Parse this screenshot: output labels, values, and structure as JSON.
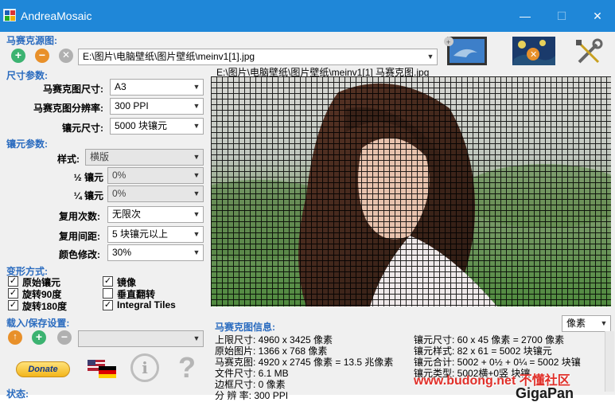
{
  "window": {
    "title": "AndreaMosaic",
    "minimize": "—",
    "maximize": "☐",
    "close": "✕"
  },
  "source": {
    "section_title": "马赛克源图:",
    "path": "E:\\图片\\电脑壁纸\\图片壁纸\\meinv1[1].jpg",
    "preview_caption": "E:\\图片\\电脑壁纸\\图片壁纸\\meinv1[1] 马赛克图.jpg"
  },
  "size_params": {
    "section_title": "尺寸参数:",
    "mosaic_size_label": "马赛克图尺寸:",
    "mosaic_size_value": "A3",
    "resolution_label": "马赛克图分辨率:",
    "resolution_value": "300 PPI",
    "tile_size_label": "镶元尺寸:",
    "tile_size_value": "5000 块镶元"
  },
  "tile_params": {
    "section_title": "镶元参数:",
    "style_label": "样式:",
    "style_value": "横版",
    "half_label": "½ 镶元",
    "half_value": "0%",
    "quarter_label": "¼ 镶元",
    "quarter_value": "0%",
    "reuse_count_label": "复用次数:",
    "reuse_count_value": "无限次",
    "reuse_distance_label": "复用间距:",
    "reuse_distance_value": "5 块镶元以上",
    "color_label": "颜色修改:",
    "color_value": "30%"
  },
  "transform": {
    "section_title": "变形方式:",
    "options": [
      {
        "label": "原始镶元",
        "checked": "✓"
      },
      {
        "label": "镜像",
        "checked": "✓"
      },
      {
        "label": "旋转90度",
        "checked": "✓"
      },
      {
        "label": "垂直翻转",
        "checked": ""
      },
      {
        "label": "旋转180度",
        "checked": "✓"
      },
      {
        "label": "Integral Tiles",
        "checked": "✓"
      }
    ]
  },
  "load_save": {
    "section_title": "载入/保存设置:"
  },
  "status": {
    "label": "状态:"
  },
  "bottom": {
    "donate": "Donate",
    "info_symbol": "i",
    "help_symbol": "?"
  },
  "info_panel": {
    "title": "马赛克图信息:",
    "unit": "像素",
    "left_lines": [
      "上限尺寸: 4960 x 3425 像素",
      "原始图片: 1366 x 768 像素",
      "马赛克图: 4920 x 2745 像素 = 13.5 兆像素",
      "文件尺寸: 6.1 MB",
      "边框尺寸: 0 像素",
      "分 辨 率: 300 PPI"
    ],
    "right_lines": [
      "镶元尺寸: 60 x 45 像素 = 2700 像素",
      "镶元样式: 82 x 61 = 5002 块镶元",
      "镶元合计:  5002 + 0½ + 0¼ = 5002 块镶",
      "镶元类型: 5002横+0竖 块镶"
    ]
  },
  "watermark": {
    "site": "www.budong.net 不懂社区",
    "brand": "GigaPan"
  },
  "colors": {
    "title_bar": "#1f87d8",
    "section": "#2a6bbf",
    "add": "#3cb371",
    "remove": "#e8902a"
  }
}
